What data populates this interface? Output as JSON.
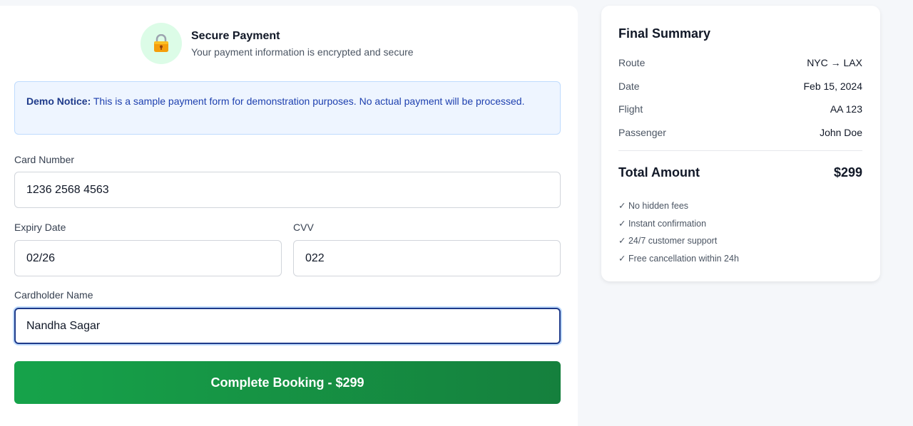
{
  "payment": {
    "title": "Secure Payment",
    "subtitle": "Your payment information is encrypted and secure",
    "notice": {
      "label": "Demo Notice:",
      "text": " This is a sample payment form for demonstration purposes. No actual payment will be processed."
    },
    "fields": {
      "card_number": {
        "label": "Card Number",
        "value": "1236 2568 4563"
      },
      "expiry": {
        "label": "Expiry Date",
        "value": "02/26"
      },
      "cvv": {
        "label": "CVV",
        "value": "022"
      },
      "cardholder": {
        "label": "Cardholder Name",
        "value": "Nandha Sagar"
      }
    },
    "submit_label": "Complete Booking - $299"
  },
  "summary": {
    "title": "Final Summary",
    "rows": [
      {
        "key": "Route",
        "value": "NYC → LAX"
      },
      {
        "key": "Date",
        "value": "Feb 15, 2024"
      },
      {
        "key": "Flight",
        "value": "AA 123"
      },
      {
        "key": "Passenger",
        "value": "John Doe"
      }
    ],
    "total_label": "Total Amount",
    "total_value": "$299",
    "perks": [
      "✓ No hidden fees",
      "✓ Instant confirmation",
      "✓ 24/7 customer support",
      "✓ Free cancellation within 24h"
    ]
  },
  "colors": {
    "accent_green": "#16a34a",
    "notice_bg": "#eef5ff",
    "focus_border": "#1e3a8a"
  }
}
